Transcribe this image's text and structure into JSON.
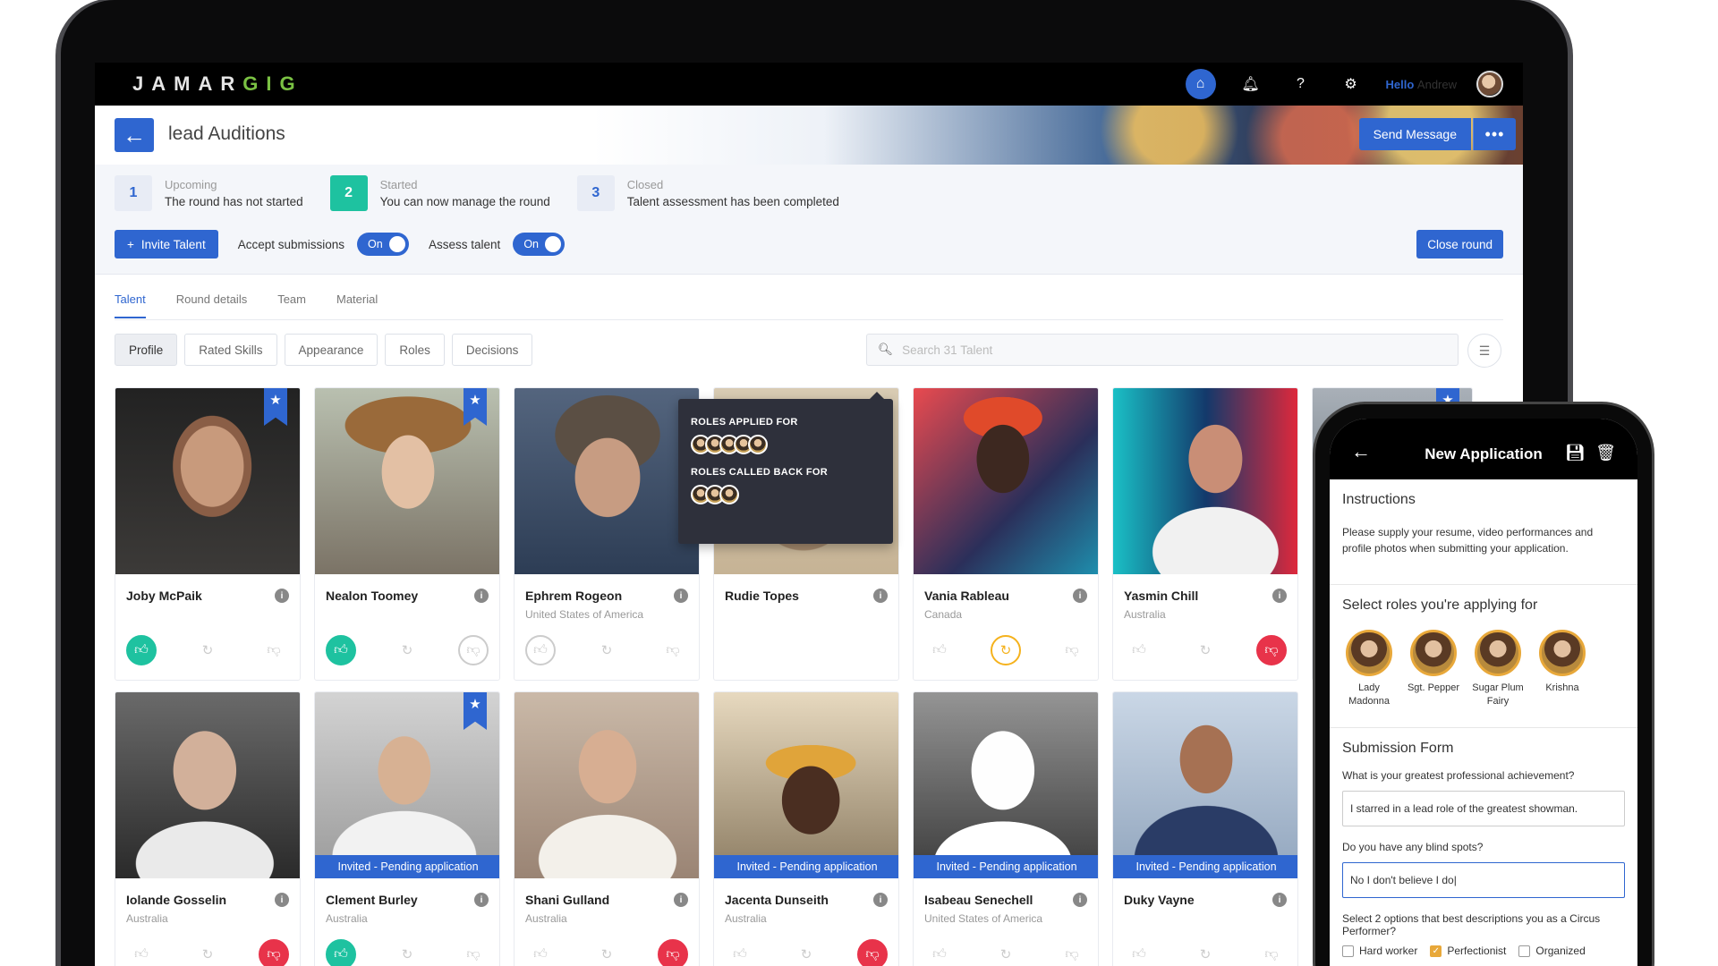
{
  "app": {
    "logo_main": "JAMAR",
    "logo_accent": "GIG",
    "hello": "Hello",
    "user_name": "Andrew"
  },
  "header": {
    "title": "lead Auditions",
    "send_message": "Send Message",
    "more": "•••"
  },
  "steps": [
    {
      "num": "1",
      "label": "Upcoming",
      "desc": "The round has not started",
      "active": false
    },
    {
      "num": "2",
      "label": "Started",
      "desc": "You can now manage the round",
      "active": true
    },
    {
      "num": "3",
      "label": "Closed",
      "desc": "Talent assessment has been completed",
      "active": false
    }
  ],
  "controls": {
    "invite": "Invite Talent",
    "accept_label": "Accept submissions",
    "accept_state": "On",
    "assess_label": "Assess talent",
    "assess_state": "On",
    "close_round": "Close round"
  },
  "tabs": [
    "Talent",
    "Round details",
    "Team",
    "Material"
  ],
  "filters": [
    "Profile",
    "Rated Skills",
    "Appearance",
    "Roles",
    "Decisions"
  ],
  "search": {
    "placeholder": "Search 31 Talent"
  },
  "pending_label": "Invited - Pending application",
  "talent": [
    {
      "name": "Joby McPaik",
      "country": ""
    },
    {
      "name": "Nealon Toomey",
      "country": ""
    },
    {
      "name": "Ephrem Rogeon",
      "country": "United States of America"
    },
    {
      "name": "Rudie Topes",
      "country": ""
    },
    {
      "name": "Vania Rableau",
      "country": "Canada"
    },
    {
      "name": "Yasmin Chill",
      "country": "Australia"
    },
    {
      "name": "Iolande Gosselin",
      "country": "Australia"
    },
    {
      "name": "Clement Burley",
      "country": "Australia"
    },
    {
      "name": "Shani Gulland",
      "country": "Australia"
    },
    {
      "name": "Jacenta Dunseith",
      "country": "Australia"
    },
    {
      "name": "Isabeau Senechell",
      "country": "United States of America"
    },
    {
      "name": "Duky Vayne",
      "country": ""
    }
  ],
  "tooltip": {
    "applied_heading": "ROLES APPLIED FOR",
    "callback_heading": "ROLES CALLED BACK FOR"
  },
  "phone": {
    "title": "New Application",
    "instructions_heading": "Instructions",
    "instructions_text": "Please supply your resume, video performances and profile photos when submitting your application.",
    "roles_heading": "Select roles you're applying for",
    "roles": [
      "Lady Madonna",
      "Sgt. Pepper",
      "Sugar Plum Fairy",
      "Krishna"
    ],
    "form_heading": "Submission Form",
    "q1": "What is your greatest professional achievement?",
    "a1": "I starred in a lead role of the greatest showman.",
    "q2": "Do you have any blind spots?",
    "a2": "No I don't believe I do|",
    "q3": "Select 2 options that best descriptions you as a Circus Performer?",
    "options": [
      "Hard worker",
      "Perfectionist",
      "Organized"
    ]
  },
  "colors": {
    "accent": "#2f66d0",
    "success": "#1ec2a0",
    "danger": "#e8334a",
    "warning": "#f5b21d",
    "brand_green": "#7ac143"
  }
}
